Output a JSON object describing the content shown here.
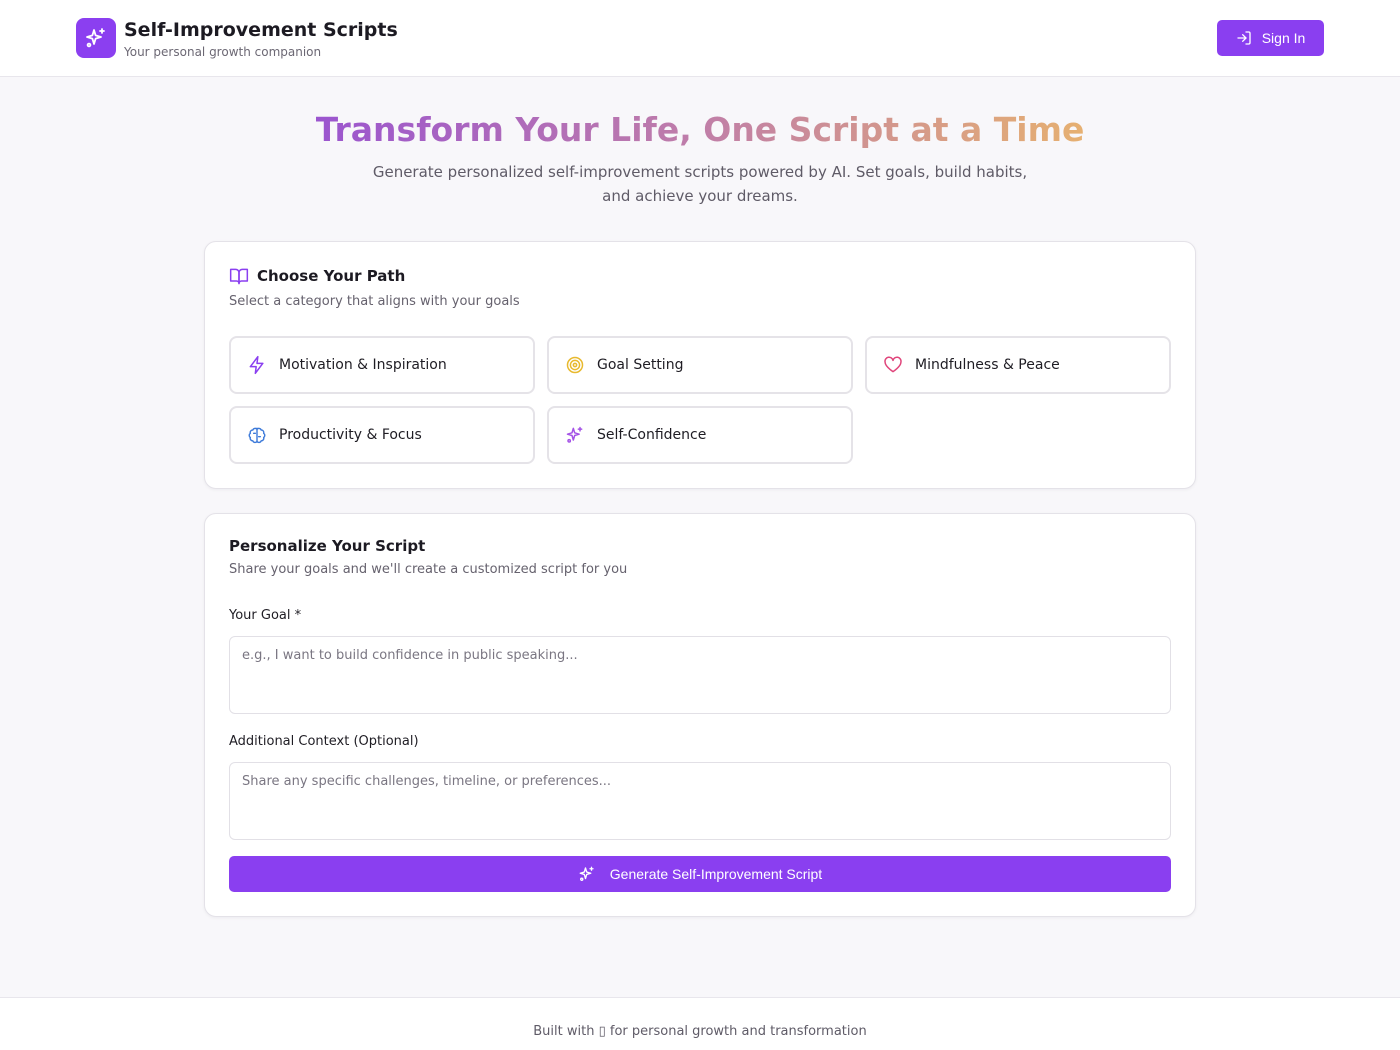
{
  "header": {
    "title": "Self-Improvement Scripts",
    "subtitle": "Your personal growth companion",
    "sign_in_label": "Sign In",
    "brand_color": "#8a3ff0"
  },
  "hero": {
    "title_part1": "Transform Your Life, One Script at a Time",
    "subtitle": "Generate personalized self-improvement scripts powered by AI. Set goals, build habits, and achieve your dreams."
  },
  "path_card": {
    "title": "Choose Your Path",
    "subtitle": "Select a category that aligns with your goals",
    "categories": [
      {
        "label": "Motivation & Inspiration",
        "icon": "lightning-icon",
        "color": "#8a3ff0"
      },
      {
        "label": "Goal Setting",
        "icon": "target-icon",
        "color": "#e8b92e"
      },
      {
        "label": "Mindfulness & Peace",
        "icon": "heart-icon",
        "color": "#e0457b"
      },
      {
        "label": "Productivity & Focus",
        "icon": "brain-icon",
        "color": "#3d7ad9"
      },
      {
        "label": "Self-Confidence",
        "icon": "sparkles-icon",
        "color": "#a452e6"
      }
    ]
  },
  "form_card": {
    "title": "Personalize Your Script",
    "subtitle": "Share your goals and we'll create a customized script for you",
    "goal_label": "Your Goal *",
    "goal_placeholder": "e.g., I want to build confidence in public speaking...",
    "context_label": "Additional Context (Optional)",
    "context_placeholder": "Share any specific challenges, timeline, or preferences...",
    "generate_label": "Generate Self-Improvement Script"
  },
  "footer": {
    "text": "Built with ▯ for personal growth and transformation"
  }
}
